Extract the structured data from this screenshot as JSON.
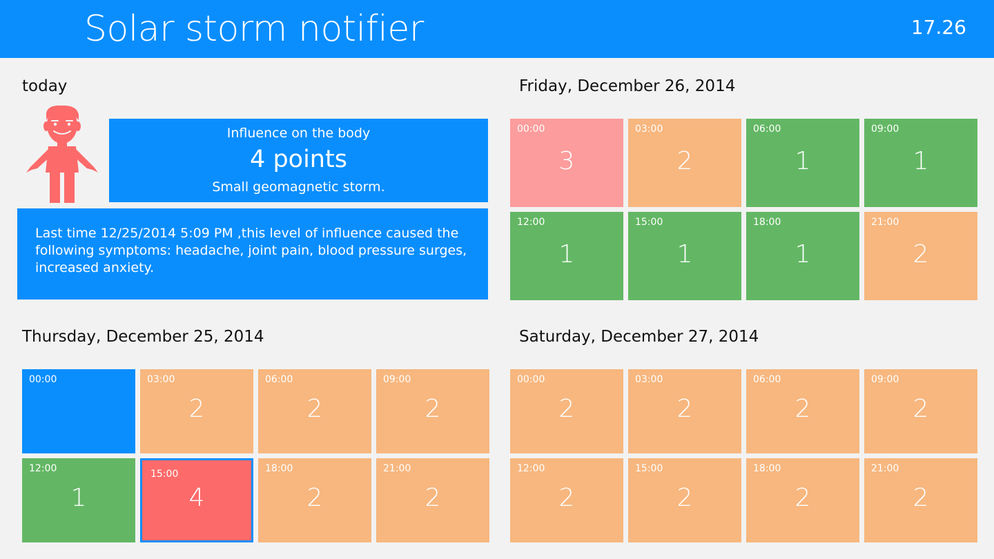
{
  "app": {
    "title": "Solar storm notifier",
    "time": "17.26"
  },
  "colors": {
    "accent": "#0a8efe",
    "green": "#63b764",
    "orange": "#f7b77f",
    "pink": "#fc9c9c",
    "red": "#fd6a6a",
    "avatar": "#fd6a6a"
  },
  "today": {
    "title": "today",
    "avatar_icon": "person-icon",
    "influence_label": "Influence on the body",
    "points": "4 points",
    "storm": "Small geomagnetic storm.",
    "history": "Last time 12/25/2014 5:09 PM ,this level of influence caused the following symptoms: headache, joint pain, blood pressure surges, increased anxiety."
  },
  "days": [
    {
      "title": "Friday, December 26, 2014",
      "tiles": [
        {
          "time": "00:00",
          "value": "3",
          "color": "#fc9c9c"
        },
        {
          "time": "03:00",
          "value": "2",
          "color": "#f7b77f"
        },
        {
          "time": "06:00",
          "value": "1",
          "color": "#63b764"
        },
        {
          "time": "09:00",
          "value": "1",
          "color": "#63b764"
        },
        {
          "time": "12:00",
          "value": "1",
          "color": "#63b764"
        },
        {
          "time": "15:00",
          "value": "1",
          "color": "#63b764"
        },
        {
          "time": "18:00",
          "value": "1",
          "color": "#63b764"
        },
        {
          "time": "21:00",
          "value": "2",
          "color": "#f7b77f"
        }
      ]
    },
    {
      "title": "Thursday, December 25, 2014",
      "tiles": [
        {
          "time": "00:00",
          "value": "",
          "color": "#0a8efe"
        },
        {
          "time": "03:00",
          "value": "2",
          "color": "#f7b77f"
        },
        {
          "time": "06:00",
          "value": "2",
          "color": "#f7b77f"
        },
        {
          "time": "09:00",
          "value": "2",
          "color": "#f7b77f"
        },
        {
          "time": "12:00",
          "value": "1",
          "color": "#63b764"
        },
        {
          "time": "15:00",
          "value": "4",
          "color": "#fd6a6a",
          "selected": true
        },
        {
          "time": "18:00",
          "value": "2",
          "color": "#f7b77f"
        },
        {
          "time": "21:00",
          "value": "2",
          "color": "#f7b77f"
        }
      ]
    },
    {
      "title": "Saturday, December 27, 2014",
      "tiles": [
        {
          "time": "00:00",
          "value": "2",
          "color": "#f7b77f"
        },
        {
          "time": "03:00",
          "value": "2",
          "color": "#f7b77f"
        },
        {
          "time": "06:00",
          "value": "2",
          "color": "#f7b77f"
        },
        {
          "time": "09:00",
          "value": "2",
          "color": "#f7b77f"
        },
        {
          "time": "12:00",
          "value": "2",
          "color": "#f7b77f"
        },
        {
          "time": "15:00",
          "value": "2",
          "color": "#f7b77f"
        },
        {
          "time": "18:00",
          "value": "2",
          "color": "#f7b77f"
        },
        {
          "time": "21:00",
          "value": "2",
          "color": "#f7b77f"
        }
      ]
    }
  ]
}
